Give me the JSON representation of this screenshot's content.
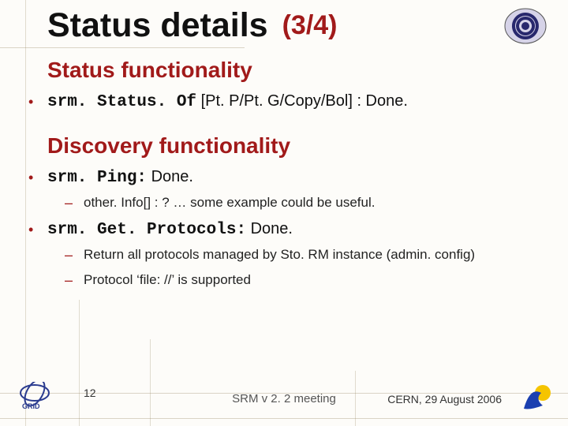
{
  "title": "Status details",
  "title_count": "(3/4)",
  "sections": {
    "status": {
      "heading": "Status functionality",
      "item1_fn": "srm. Status. Of",
      "item1_rest": " [Pt. P/Pt. G/Copy/Bol] : Done."
    },
    "discovery": {
      "heading": "Discovery functionality",
      "ping_fn": "srm. Ping:",
      "ping_rest": "  Done.",
      "ping_sub1": "other. Info[] : ? … some example could be useful.",
      "getproto_fn": "srm. Get. Protocols:",
      "getproto_rest": "  Done.",
      "getproto_sub1": "Return all protocols managed by Sto. RM instance (admin. config)",
      "getproto_sub2": "Protocol ‘file: //’ is supported"
    }
  },
  "footer": {
    "slide_no": "12",
    "meeting": "SRM v 2. 2 meeting",
    "place_date": "CERN,  29 August 2006"
  },
  "icons": {
    "swirl": "swirl-logo",
    "infn": "infn-grid-logo",
    "e": "enabling-grids-logo"
  }
}
